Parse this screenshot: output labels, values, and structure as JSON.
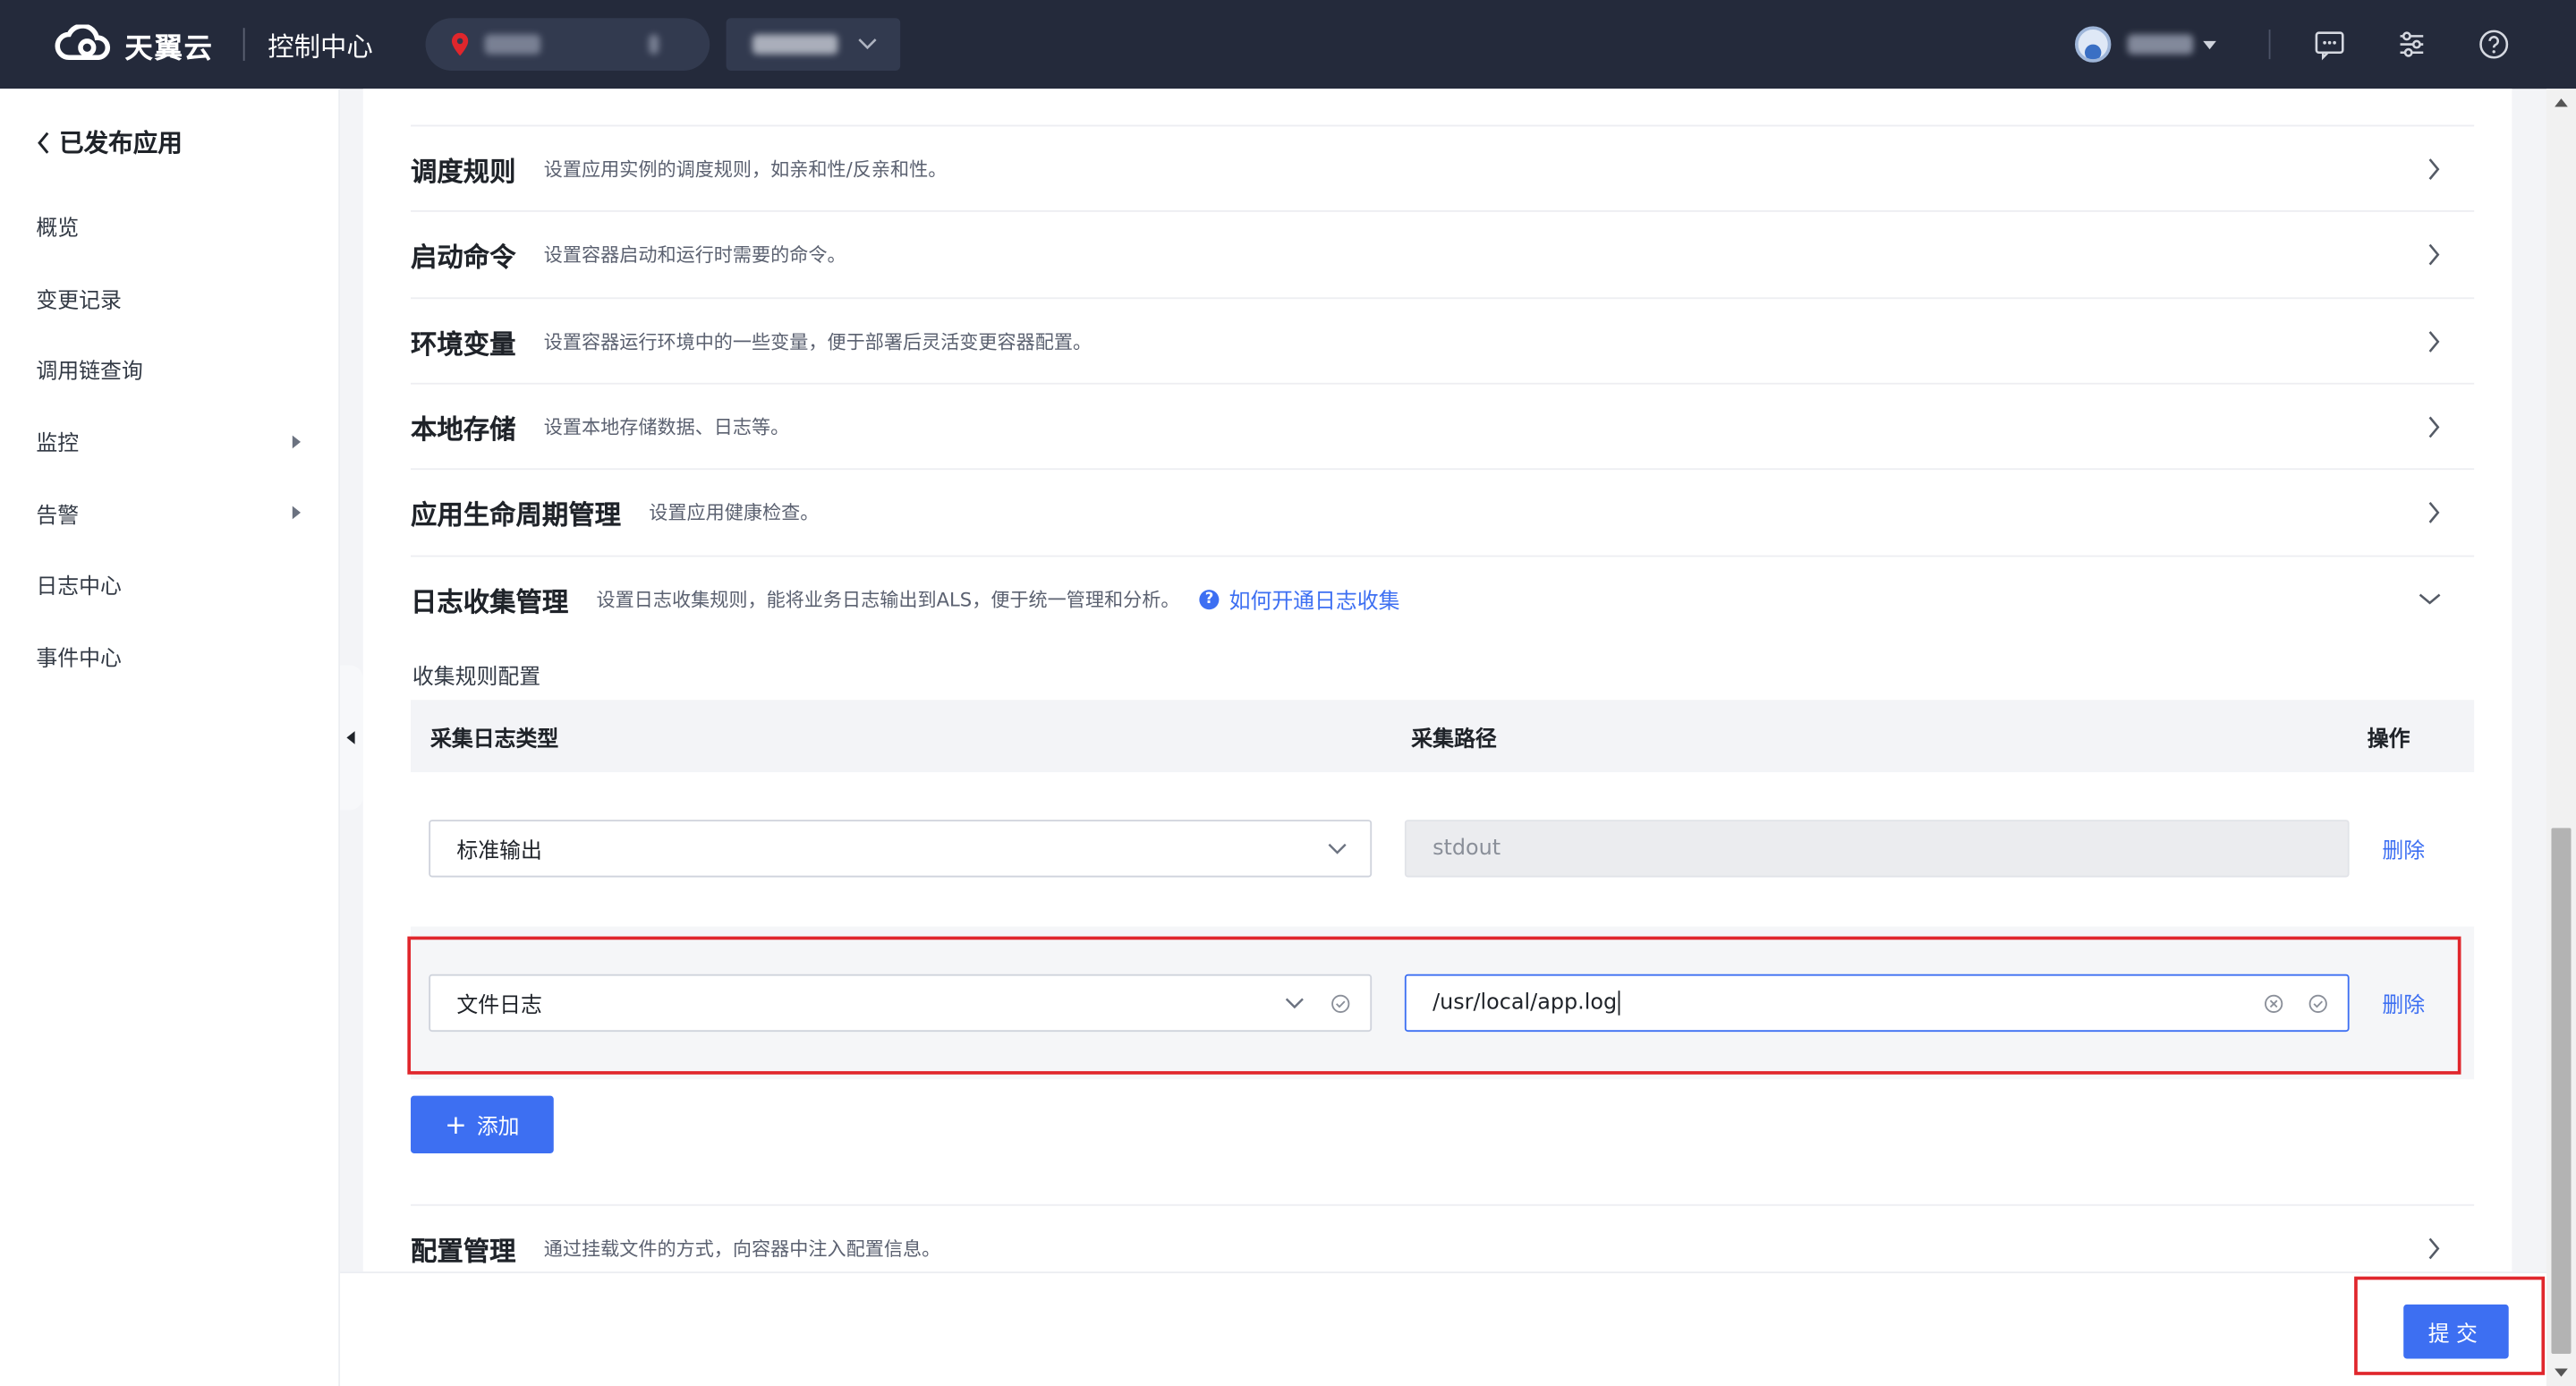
{
  "topbar": {
    "brand": "天翼云",
    "console_title": "控制中心",
    "user_caret": "▾",
    "icons": [
      "cloud-logo-icon",
      "location-pin-icon",
      "chevron-down-icon",
      "message-icon",
      "settings-sliders-icon",
      "help-icon"
    ]
  },
  "sidebar": {
    "back_label": "已发布应用",
    "items": [
      {
        "label": "概览"
      },
      {
        "label": "变更记录"
      },
      {
        "label": "调用链查询"
      },
      {
        "label": "监控",
        "has_submenu": true
      },
      {
        "label": "告警",
        "has_submenu": true
      },
      {
        "label": "日志中心"
      },
      {
        "label": "事件中心"
      }
    ]
  },
  "sections": [
    {
      "title": "调度规则",
      "desc": "设置应用实例的调度规则，如亲和性/反亲和性。",
      "expanded": false
    },
    {
      "title": "启动命令",
      "desc": "设置容器启动和运行时需要的命令。",
      "expanded": false
    },
    {
      "title": "环境变量",
      "desc": "设置容器运行环境中的一些变量，便于部署后灵活变更容器配置。",
      "expanded": false
    },
    {
      "title": "本地存储",
      "desc": "设置本地存储数据、日志等。",
      "expanded": false
    },
    {
      "title": "应用生命周期管理",
      "desc": "设置应用健康检查。",
      "expanded": false
    },
    {
      "title": "日志收集管理",
      "desc": "设置日志收集规则，能将业务日志输出到ALS，便于统一管理和分析。",
      "expanded": true,
      "help_link": "如何开通日志收集"
    },
    {
      "title": "配置管理",
      "desc": "通过挂载文件的方式，向容器中注入配置信息。",
      "expanded": false
    }
  ],
  "log_collection": {
    "subheading": "收集规则配置",
    "columns": {
      "type": "采集日志类型",
      "path": "采集路径",
      "op": "操作"
    },
    "rules": [
      {
        "type": "标准输出",
        "path": "stdout",
        "path_editable": false,
        "delete": "删除"
      },
      {
        "type": "文件日志",
        "path": "/usr/local/app.log",
        "path_editable": true,
        "delete": "删除"
      }
    ],
    "add_label": "添加"
  },
  "footer": {
    "submit_label": "提交"
  },
  "colors": {
    "primary": "#3d6ff2",
    "topbar": "#242a3b",
    "highlight": "#e0262c"
  }
}
